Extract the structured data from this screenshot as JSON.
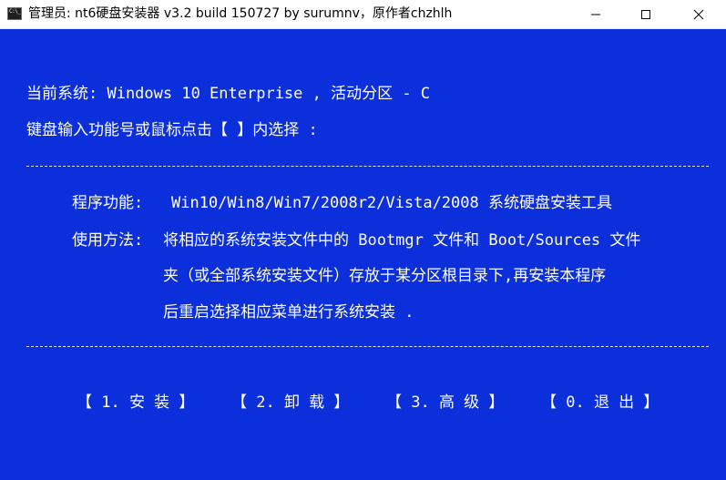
{
  "window": {
    "title": "管理员: nt6硬盘安装器 v3.2 build 150727 by surumnv，原作者chzhlh",
    "icon": "console-icon"
  },
  "console": {
    "current_system": "当前系统: Windows 10 Enterprise , 活动分区 - C",
    "input_prompt": "键盘输入功能号或鼠标点击【  】内选择 :",
    "function_label": "程序功能:",
    "function_text": "Win10/Win8/Win7/2008r2/Vista/2008 系统硬盘安装工具",
    "usage_label": "使用方法:",
    "usage_line1": "将相应的系统安装文件中的 Bootmgr 文件和 Boot/Sources 文件",
    "usage_line2": "夹（或全部系统安装文件）存放于某分区根目录下,再安装本程序",
    "usage_line3": "后重启选择相应菜单进行系统安装 .",
    "separator": "-----------------------------------------------------------------------------------------------------------------------",
    "menu": [
      {
        "label": "【 1. 安 装  】"
      },
      {
        "label": "【 2. 卸 载  】"
      },
      {
        "label": "【 3. 高 级  】"
      },
      {
        "label": "【 0. 退 出  】"
      }
    ]
  },
  "colors": {
    "console_bg": "#0c2fdc",
    "console_text": "#ffffff",
    "titlebar_bg": "#ffffff"
  }
}
